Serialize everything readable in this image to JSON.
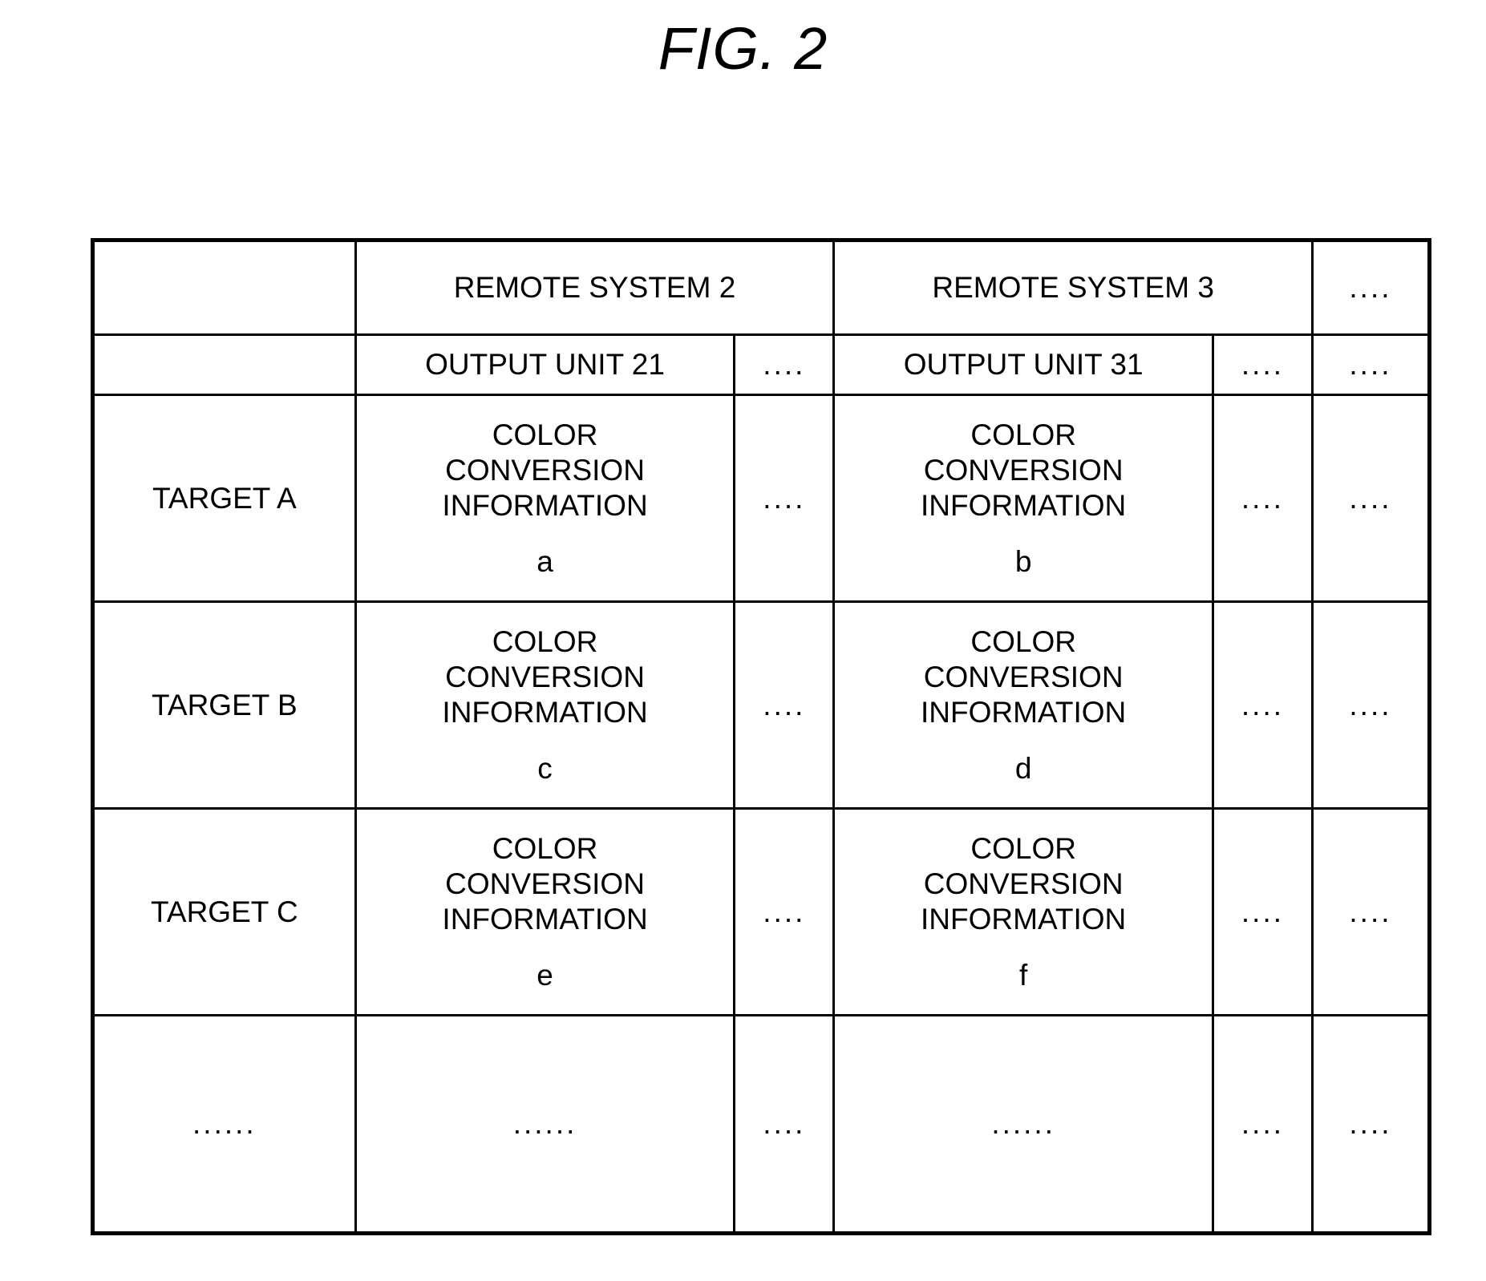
{
  "figure": {
    "title": "FIG. 2"
  },
  "table": {
    "header_row_1": [
      {
        "label": "",
        "colspan": 1
      },
      {
        "label": "REMOTE SYSTEM 2",
        "colspan": 2
      },
      {
        "label": "REMOTE SYSTEM 3",
        "colspan": 2
      },
      {
        "label": "....",
        "colspan": 1
      }
    ],
    "header_row_2": [
      {
        "label": ""
      },
      {
        "label": "OUTPUT UNIT 21"
      },
      {
        "label": "...."
      },
      {
        "label": "OUTPUT UNIT 31"
      },
      {
        "label": "...."
      },
      {
        "label": "...."
      }
    ],
    "rows": [
      {
        "target": "TARGET A",
        "cell_1_text": "COLOR\nCONVERSION\nINFORMATION",
        "cell_1_suffix": "a",
        "dots_1": "....",
        "cell_2_text": "COLOR\nCONVERSION\nINFORMATION",
        "cell_2_suffix": "b",
        "dots_2": "....",
        "dots_3": "...."
      },
      {
        "target": "TARGET B",
        "cell_1_text": "COLOR\nCONVERSION\nINFORMATION",
        "cell_1_suffix": "c",
        "dots_1": "....",
        "cell_2_text": "COLOR\nCONVERSION\nINFORMATION",
        "cell_2_suffix": "d",
        "dots_2": "....",
        "dots_3": "...."
      },
      {
        "target": "TARGET C",
        "cell_1_text": "COLOR\nCONVERSION\nINFORMATION",
        "cell_1_suffix": "e",
        "dots_1": "....",
        "cell_2_text": "COLOR\nCONVERSION\nINFORMATION",
        "cell_2_suffix": "f",
        "dots_2": "....",
        "dots_3": "...."
      }
    ],
    "tail_row": {
      "target": "......",
      "cell_1": "......",
      "dots_1": "....",
      "cell_2": "......",
      "dots_2": "....",
      "dots_3": "...."
    }
  }
}
